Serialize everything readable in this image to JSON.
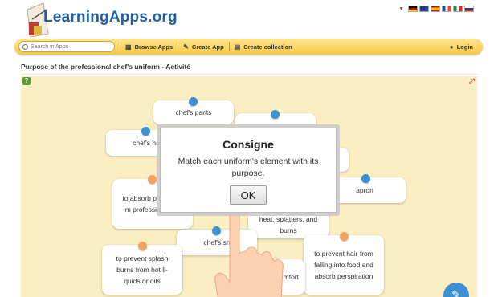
{
  "site": {
    "logo_text": "LearningApps.org"
  },
  "languages": [
    "de",
    "en",
    "es",
    "fr",
    "it",
    "ru"
  ],
  "toolbar": {
    "search_placeholder": "Search in Apps",
    "browse_label": "Browse Apps",
    "create_label": "Create App",
    "collection_label": "Create collection",
    "login_label": "Login"
  },
  "page": {
    "title": "Purpose of the professional chef's uniform - Activité"
  },
  "cards": {
    "chef_pants": "chef's pants",
    "chef_hat": "chef's ha",
    "apron": "apron",
    "chef_shoes": "chef's sh",
    "absorb": "to absorb p tion and m professionalism",
    "splash": "to prevent splash burns from hot li-quids or oils",
    "heat": "heat, splatters, and burns",
    "hair": "to prevent hair from falling into food and absorb perspiration",
    "comfort": "mfort"
  },
  "dialog": {
    "title": "Consigne",
    "text": "Match each uniform's element with its purpose.",
    "ok_label": "OK"
  },
  "colors": {
    "toolbar": "#f5c842",
    "game_bg": "#fbefc2",
    "dot_blue": "#3f91d6",
    "dot_orange": "#f2a163"
  }
}
